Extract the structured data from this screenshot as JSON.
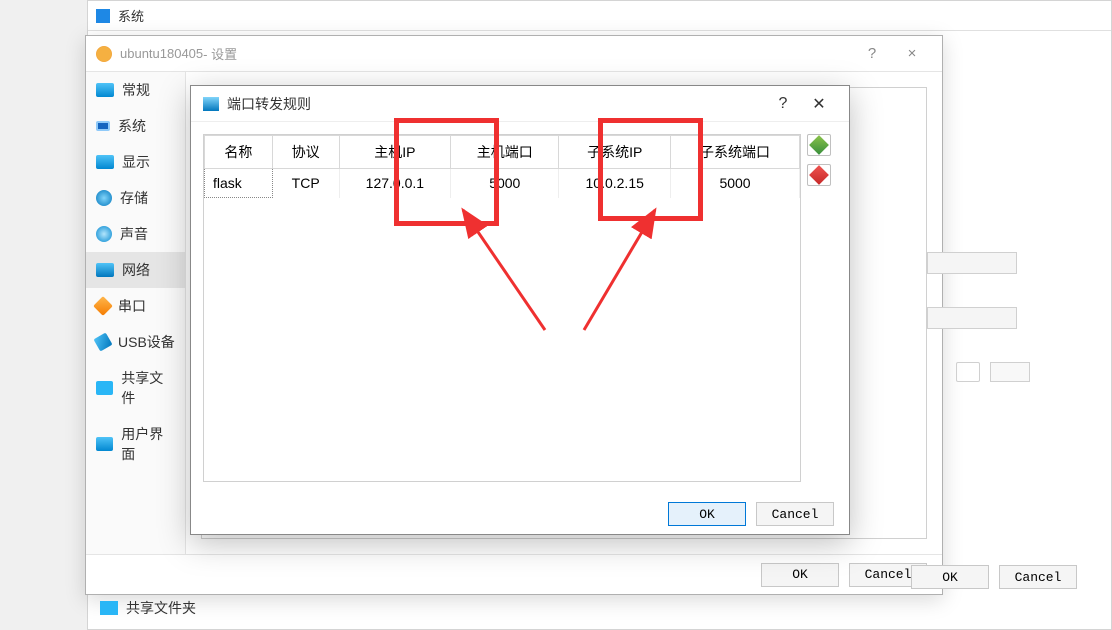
{
  "bg_window": {
    "title": "系统"
  },
  "settings": {
    "title_vm": "ubuntu180405",
    "title_suffix": " - 设置",
    "help": "?",
    "close": "×",
    "sidebar": [
      {
        "label": "常规"
      },
      {
        "label": "系统"
      },
      {
        "label": "显示"
      },
      {
        "label": "存储"
      },
      {
        "label": "声音"
      },
      {
        "label": "网络"
      },
      {
        "label": "串口"
      },
      {
        "label": "USB设备"
      },
      {
        "label": "共享文件"
      },
      {
        "label": "用户界面"
      }
    ],
    "ok": "OK",
    "cancel": "Cancel"
  },
  "pf": {
    "title": "端口转发规则",
    "help": "?",
    "close": "✕",
    "headers": {
      "name": "名称",
      "protocol": "协议",
      "host_ip": "主机IP",
      "host_port": "主机端口",
      "guest_ip": "子系统IP",
      "guest_port": "子系统端口"
    },
    "rows": [
      {
        "name": "flask",
        "protocol": "TCP",
        "host_ip": "127.0.0.1",
        "host_port": "5000",
        "guest_ip": "10.0.2.15",
        "guest_port": "5000"
      }
    ],
    "ok": "OK",
    "cancel": "Cancel"
  },
  "bottom": {
    "shared": "共享文件夹"
  },
  "outer": {
    "ok": "OK",
    "cancel": "Cancel"
  },
  "annotation": {
    "highlight_columns": [
      "host_ip",
      "guest_ip"
    ],
    "color": "#ef3030"
  }
}
